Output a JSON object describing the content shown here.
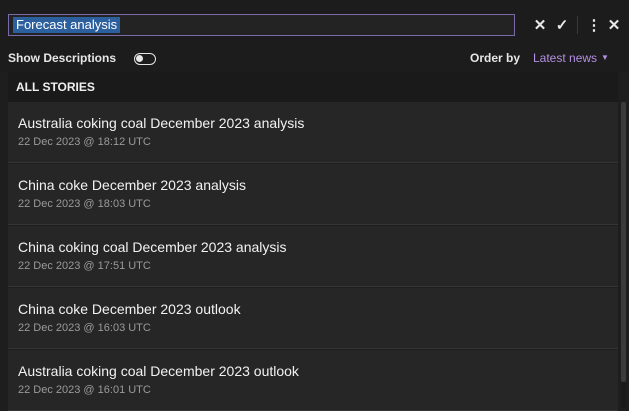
{
  "search": {
    "value": "Forecast analysis",
    "selected_text": "Forecast analysis"
  },
  "toolbar": {
    "clear_icon": "close-icon",
    "clear_glyph": "✕",
    "confirm_icon": "check-icon",
    "confirm_glyph": "✓",
    "more_icon": "more-vertical-icon",
    "more_glyph": "⋮",
    "close_icon": "close-icon",
    "close_glyph": "✕"
  },
  "options": {
    "show_descriptions_label": "Show Descriptions",
    "show_descriptions_on": false,
    "order_by_label": "Order by",
    "order_by_value": "Latest news",
    "order_caret": "▼"
  },
  "section": {
    "title": "ALL STORIES"
  },
  "stories": [
    {
      "title": "Australia coking coal December 2023 analysis",
      "time": "22 Dec 2023 @ 18:12 UTC"
    },
    {
      "title": "China coke December 2023 analysis",
      "time": "22 Dec 2023 @ 18:03 UTC"
    },
    {
      "title": "China coking coal December 2023 analysis",
      "time": "22 Dec 2023 @ 17:51 UTC"
    },
    {
      "title": "China coke December 2023 outlook",
      "time": "22 Dec 2023 @ 16:03 UTC"
    },
    {
      "title": "Australia coking coal December 2023 outlook",
      "time": "22 Dec 2023 @ 16:01 UTC"
    }
  ],
  "colors": {
    "background": "#1e1e1e",
    "accent": "#b48fe3",
    "search_border": "#7b6aa8",
    "selection": "#2c5f9e",
    "row_bg": "#262626"
  }
}
